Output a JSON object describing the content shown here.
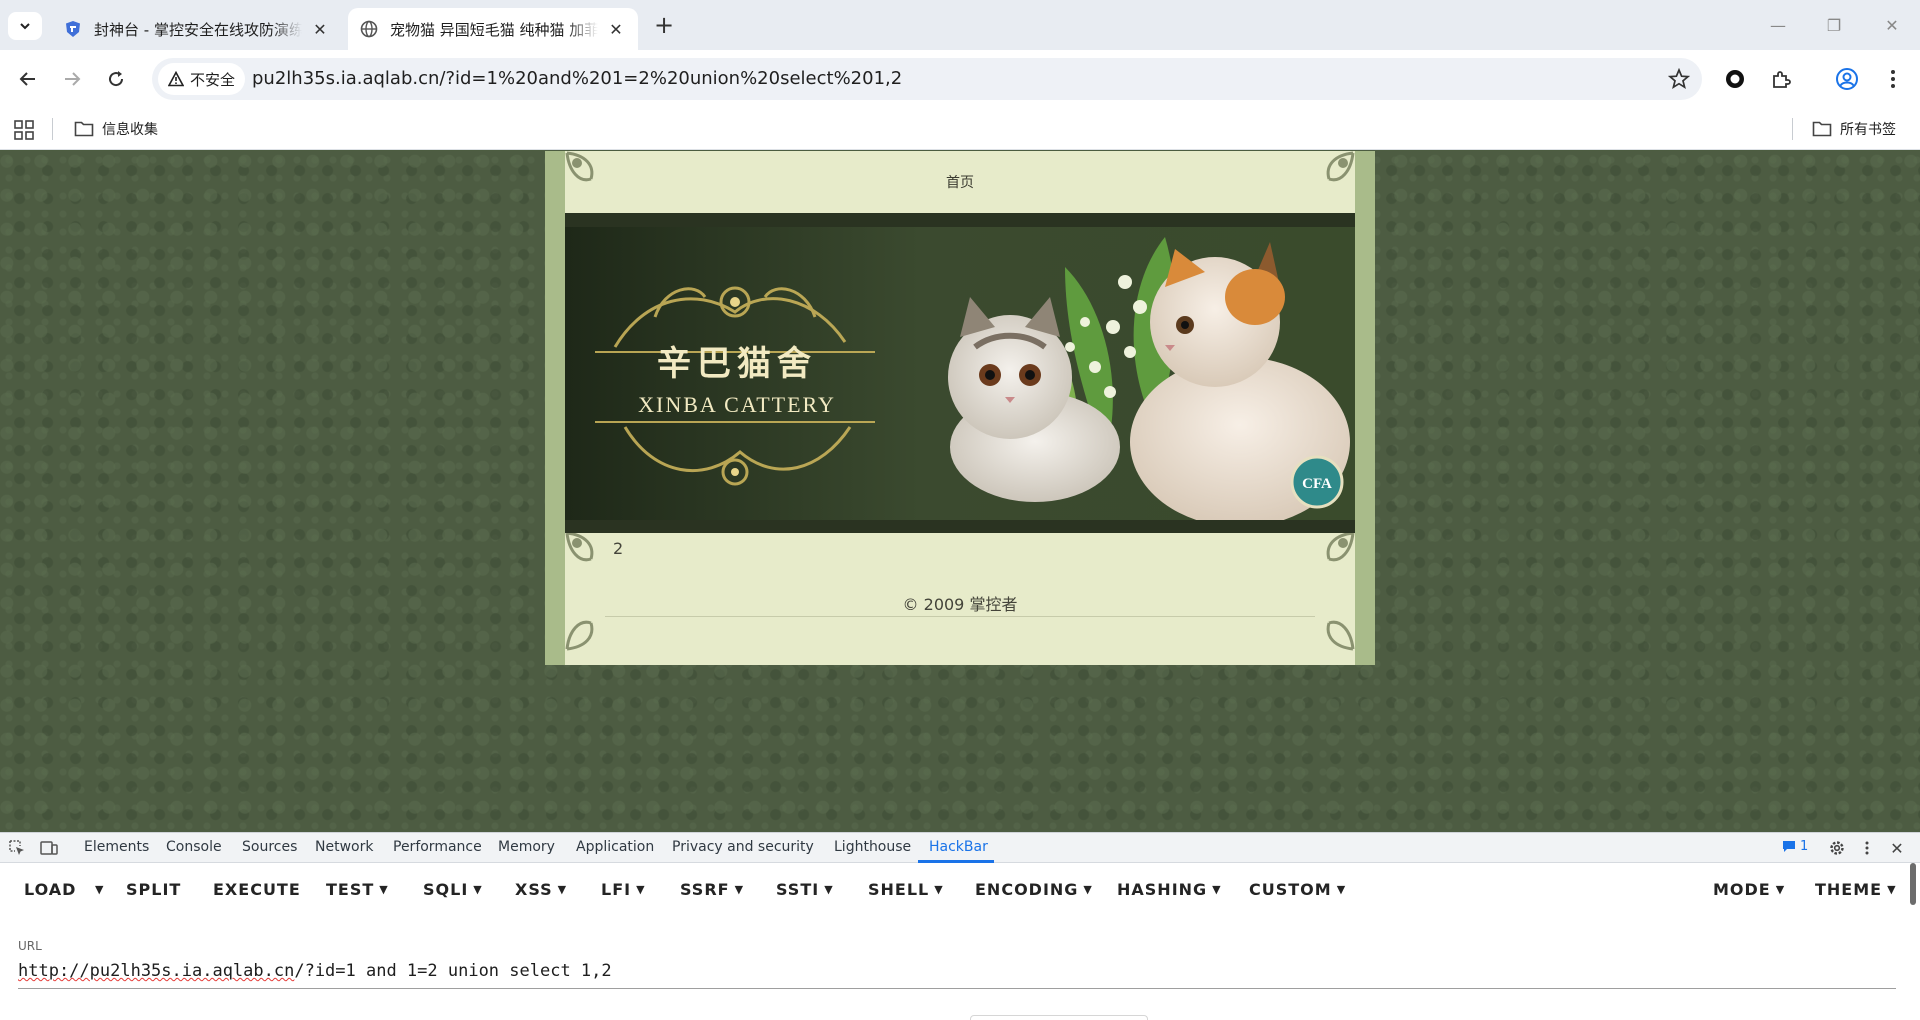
{
  "browser": {
    "tabs": [
      {
        "title": "封神台 - 掌控安全在线攻防演练靶场",
        "active": false
      },
      {
        "title": "宠物猫 异国短毛猫 纯种猫 加菲猫",
        "active": true
      }
    ],
    "address": {
      "security_label": "不安全",
      "url": "pu2lh35s.ia.aqlab.cn/?id=1%20and%201=2%20union%20select%201,2"
    },
    "bookmarks": {
      "left": [
        {
          "label": "信息收集"
        }
      ],
      "right": {
        "label": "所有书签"
      }
    }
  },
  "page": {
    "nav_label": "首页",
    "banner": {
      "title_cn": "辛巴猫舍",
      "title_en": "XINBA  CATTERY",
      "badge": "CFA"
    },
    "content_value": "2",
    "footer": "© 2009 掌控者"
  },
  "devtools": {
    "tabs": [
      "Elements",
      "Console",
      "Sources",
      "Network",
      "Performance",
      "Memory",
      "Application",
      "Privacy and security",
      "Lighthouse",
      "HackBar"
    ],
    "active_tab": "HackBar",
    "issues_count": "1",
    "hackbar": {
      "buttons": [
        {
          "label": "LOAD",
          "dropdown": false
        },
        {
          "label": "SPLIT",
          "dropdown": false
        },
        {
          "label": "EXECUTE",
          "dropdown": false
        },
        {
          "label": "TEST",
          "dropdown": true
        },
        {
          "label": "SQLI",
          "dropdown": true
        },
        {
          "label": "XSS",
          "dropdown": true
        },
        {
          "label": "LFI",
          "dropdown": true
        },
        {
          "label": "SSRF",
          "dropdown": true
        },
        {
          "label": "SSTI",
          "dropdown": true
        },
        {
          "label": "SHELL",
          "dropdown": true
        },
        {
          "label": "ENCODING",
          "dropdown": true
        },
        {
          "label": "HASHING",
          "dropdown": true
        },
        {
          "label": "CUSTOM",
          "dropdown": true
        }
      ],
      "right_buttons": [
        {
          "label": "MODE",
          "dropdown": true
        },
        {
          "label": "THEME",
          "dropdown": true
        }
      ],
      "url_label": "URL",
      "url_host": "http://pu2lh35s.ia.aqlab.cn",
      "url_rest": "/?id=1 and 1=2 union select 1,2"
    }
  }
}
